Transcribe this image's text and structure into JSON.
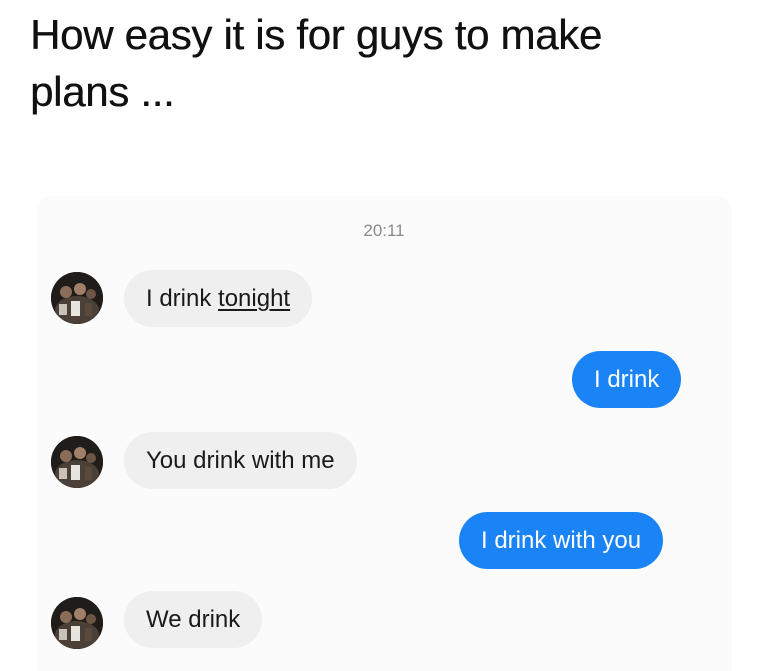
{
  "headline": {
    "line1": "How easy it is for guys to make",
    "line2": "plans ..."
  },
  "chat": {
    "timestamp": "20:11",
    "messages": [
      {
        "sender": "them",
        "text_before": "I drink ",
        "text_link": "tonight",
        "avatar_icon": "contact-avatar"
      },
      {
        "sender": "me",
        "text": "I drink"
      },
      {
        "sender": "them",
        "text": "You drink with me",
        "avatar_icon": "contact-avatar"
      },
      {
        "sender": "me",
        "text": "I drink with you"
      },
      {
        "sender": "them",
        "text": "We drink",
        "avatar_icon": "contact-avatar"
      }
    ]
  },
  "colors": {
    "outgoing_bubble": "#1a83f5",
    "incoming_bubble": "#efefef",
    "timestamp_text": "#8a8a8a",
    "panel_background": "#fbfbfb"
  }
}
